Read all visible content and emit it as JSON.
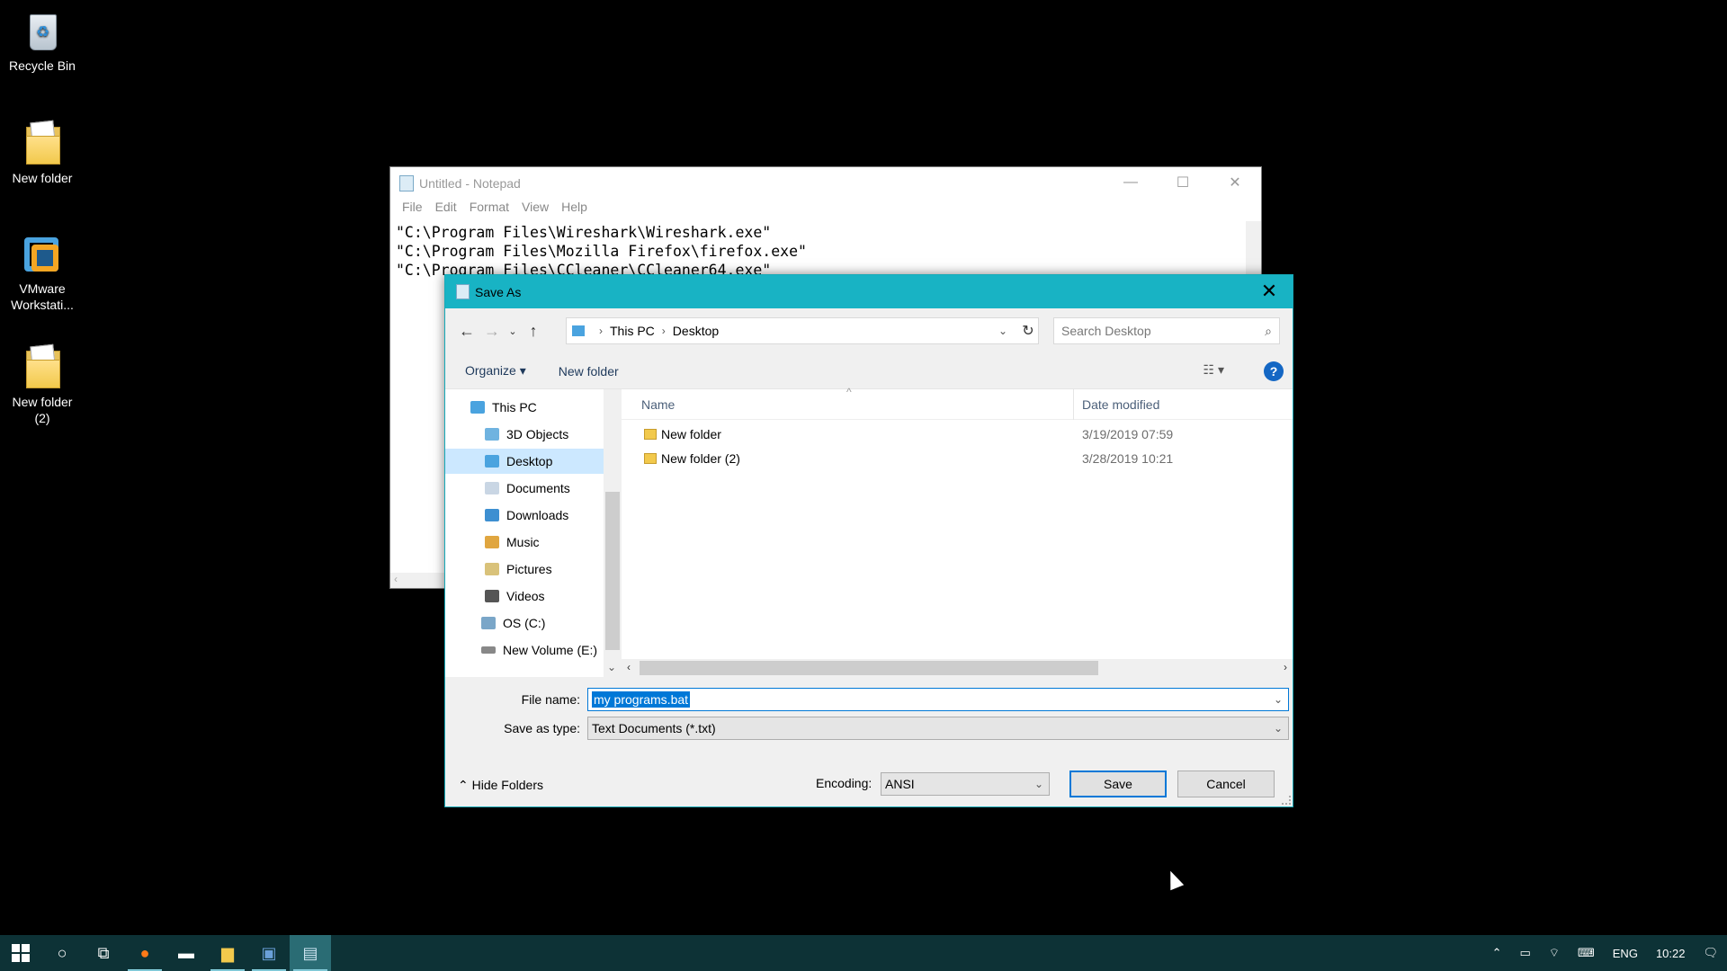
{
  "desktop": {
    "icons": [
      {
        "label": "Recycle Bin"
      },
      {
        "label": "New folder"
      },
      {
        "label": "VMware Workstati..."
      },
      {
        "label": "New folder (2)"
      }
    ]
  },
  "notepad": {
    "title": "Untitled - Notepad",
    "menu": [
      "File",
      "Edit",
      "Format",
      "View",
      "Help"
    ],
    "lines": [
      "\"C:\\Program Files\\Wireshark\\Wireshark.exe\"",
      "\"C:\\Program Files\\Mozilla Firefox\\firefox.exe\"",
      "\"C:\\Program Files\\CCleaner\\CCleaner64.exe\""
    ]
  },
  "dialog": {
    "title": "Save As",
    "breadcrumb": [
      "This PC",
      "Desktop"
    ],
    "search_placeholder": "Search Desktop",
    "organize_label": "Organize",
    "new_folder_label": "New folder",
    "tree": [
      {
        "label": "This PC",
        "color": "#4aa3df"
      },
      {
        "label": "3D Objects",
        "color": "#6fb3e0"
      },
      {
        "label": "Desktop",
        "color": "#4aa3df"
      },
      {
        "label": "Documents",
        "color": "#c9d6e4"
      },
      {
        "label": "Downloads",
        "color": "#3d8fd1"
      },
      {
        "label": "Music",
        "color": "#e0a640"
      },
      {
        "label": "Pictures",
        "color": "#d9c27a"
      },
      {
        "label": "Videos",
        "color": "#555555"
      },
      {
        "label": "OS (C:)",
        "color": "#7aa6c8"
      },
      {
        "label": "New Volume (E:)",
        "color": "#888888"
      }
    ],
    "columns": {
      "name": "Name",
      "date": "Date modified"
    },
    "files": [
      {
        "name": "New folder",
        "date": "3/19/2019 07:59"
      },
      {
        "name": "New folder (2)",
        "date": "3/28/2019 10:21"
      }
    ],
    "file_name_label": "File name:",
    "file_name_value": "my programs.bat",
    "save_type_label": "Save as type:",
    "save_type_value": "Text Documents (*.txt)",
    "hide_folders_label": "Hide Folders",
    "encoding_label": "Encoding:",
    "encoding_value": "ANSI",
    "save_label": "Save",
    "cancel_label": "Cancel",
    "accent": "#18b3c4"
  },
  "tray": {
    "language": "ENG",
    "time": "10:22"
  }
}
